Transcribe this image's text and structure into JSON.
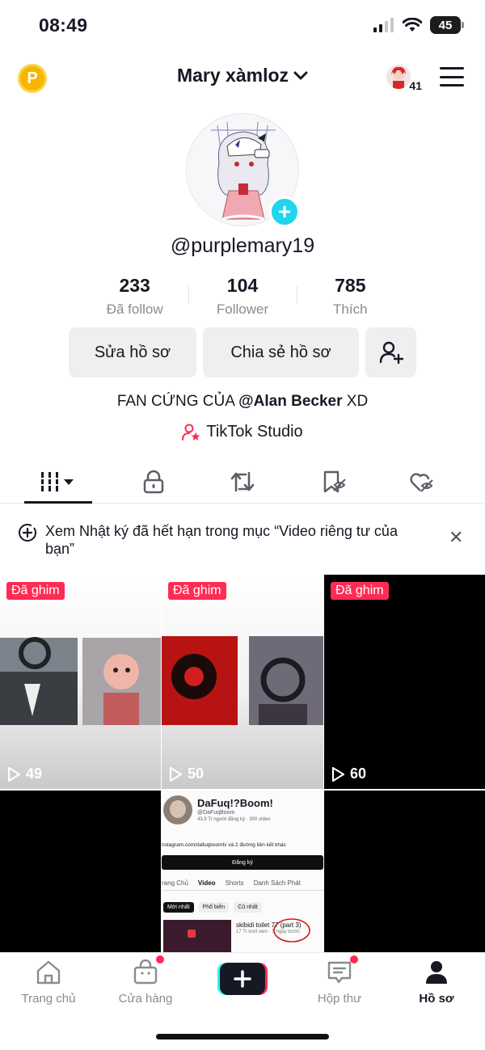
{
  "status_bar": {
    "time": "08:49",
    "battery": "45"
  },
  "header": {
    "coin_label": "P",
    "username": "Mary xàmloz",
    "friend_count": "41"
  },
  "profile": {
    "handle": "@purplemary19"
  },
  "stats": [
    {
      "value": "233",
      "label": "Đã follow"
    },
    {
      "value": "104",
      "label": "Follower"
    },
    {
      "value": "785",
      "label": "Thích"
    }
  ],
  "actions": {
    "edit": "Sửa hồ sơ",
    "share": "Chia sẻ hồ sơ"
  },
  "bio": {
    "prefix": "FAN CỨNG CỦA ",
    "mention": "@Alan Becker",
    "suffix": " XD"
  },
  "studio": {
    "label": "TikTok Studio"
  },
  "notice": {
    "text": "Xem Nhật ký đã hết hạn trong mục “Video riêng tư của bạn”"
  },
  "videos": [
    {
      "pinned_label": "Đã ghim",
      "views": "49"
    },
    {
      "pinned_label": "Đã ghim",
      "views": "50"
    },
    {
      "pinned_label": "Đã ghim",
      "views": "60"
    }
  ],
  "thumb_screenshot": {
    "channel": "DaFuq!?Boom!",
    "handle": "@DaFuqBoom",
    "subs": "43,9 Tr người đăng ký · 300 video",
    "link": "nstagram.com/dafuqboomtv và 2 đường liên kết khác",
    "subscribe": "Đăng ký",
    "tabs": [
      "rang Chủ",
      "Video",
      "Shorts",
      "Danh Sách Phát"
    ],
    "filters": [
      "Mới nhất",
      "Phổ biến",
      "Cũ nhất"
    ],
    "video_title": "skibidi toilet 77 (part 3)",
    "video_meta": "17 Tr lượt xem · 5 ngày trước"
  },
  "bottom_nav": [
    {
      "label": "Trang chủ"
    },
    {
      "label": "Cửa hàng"
    },
    {
      "label": ""
    },
    {
      "label": "Hộp thư"
    },
    {
      "label": "Hồ sơ"
    }
  ]
}
